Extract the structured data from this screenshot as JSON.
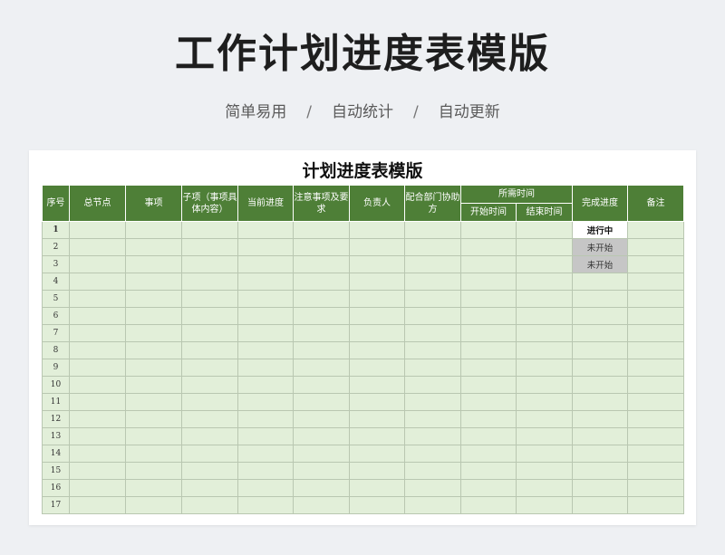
{
  "header": {
    "title": "工作计划进度表模版",
    "features": [
      "简单易用",
      "自动统计",
      "自动更新"
    ],
    "separator": "/"
  },
  "sheet": {
    "title": "计划进度表模版",
    "columns": {
      "seq": "序号",
      "main_node": "总节点",
      "item": "事项",
      "sub_item": "子项（事项具体内容）",
      "progress": "当前进度",
      "notes_req": "注意事项及要求",
      "owner": "负责人",
      "dept": "配合部门协助方",
      "time_group": "所需时间",
      "start_time": "开始时间",
      "end_time": "结束时间",
      "status": "完成进度",
      "remark": "备注"
    },
    "rows": [
      {
        "seq": "1",
        "status": "进行中"
      },
      {
        "seq": "2",
        "status": "未开始"
      },
      {
        "seq": "3",
        "status": "未开始"
      },
      {
        "seq": "4",
        "status": ""
      },
      {
        "seq": "5",
        "status": ""
      },
      {
        "seq": "6",
        "status": ""
      },
      {
        "seq": "7",
        "status": ""
      },
      {
        "seq": "8",
        "status": ""
      },
      {
        "seq": "9",
        "status": ""
      },
      {
        "seq": "10",
        "status": ""
      },
      {
        "seq": "11",
        "status": ""
      },
      {
        "seq": "12",
        "status": ""
      },
      {
        "seq": "13",
        "status": ""
      },
      {
        "seq": "14",
        "status": ""
      },
      {
        "seq": "15",
        "status": ""
      },
      {
        "seq": "16",
        "status": ""
      },
      {
        "seq": "17",
        "status": ""
      }
    ],
    "colors": {
      "header_bg": "#4e7f37",
      "cell_bg": "#e2efd9",
      "not_started_bg": "#c6c6c6"
    }
  }
}
